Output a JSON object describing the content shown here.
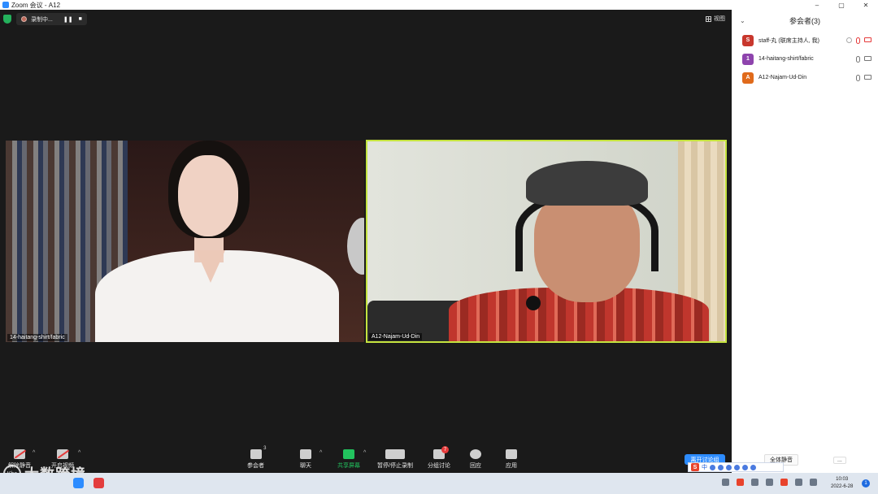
{
  "window": {
    "title": "Zoom 会议 - A12",
    "controls": [
      "–",
      "▢",
      "✕"
    ]
  },
  "meeting": {
    "recording_label": "录制中...",
    "pause_icon": "❚❚",
    "stop_icon": "■",
    "view_label": "视图"
  },
  "tiles": [
    {
      "name": "14-haitang-shirt/fabric"
    },
    {
      "name": "A12-Najam-Ud-Din"
    }
  ],
  "toolbar": {
    "unmute": "解除静音",
    "start_video": "开启视频",
    "participants": "参会者",
    "participants_count": "3",
    "chat": "聊天",
    "share": "共享屏幕",
    "record": "暂停/停止录制",
    "breakout": "分组讨论",
    "breakout_badge": "7",
    "reactions": "回应",
    "apps": "应用",
    "end": "离开讨论组",
    "caret": "^"
  },
  "panel": {
    "chevron": "⌄",
    "title": "参会者(3)",
    "participants": [
      {
        "initial": "S",
        "name": "staff-丸 (联席主持人, 我)",
        "color": "#c8372d",
        "muted": true,
        "video_off": true
      },
      {
        "initial": "1",
        "name": "14-haitang-shirt/fabric",
        "color": "#8e44ad",
        "muted": false,
        "video_off": false
      },
      {
        "initial": "A",
        "name": "A12-Najam-Ud-Din",
        "color": "#e06a1b",
        "muted": false,
        "video_off": false
      }
    ],
    "mute_all": "全体静音",
    "more": "..."
  },
  "ime": {
    "logo": "S",
    "mode": "中"
  },
  "watermark": {
    "logo_text": "Kbo",
    "text": "大数跨境"
  },
  "taskbar": {
    "time": "10:03",
    "date": "2022-6-28",
    "notification": "1"
  }
}
